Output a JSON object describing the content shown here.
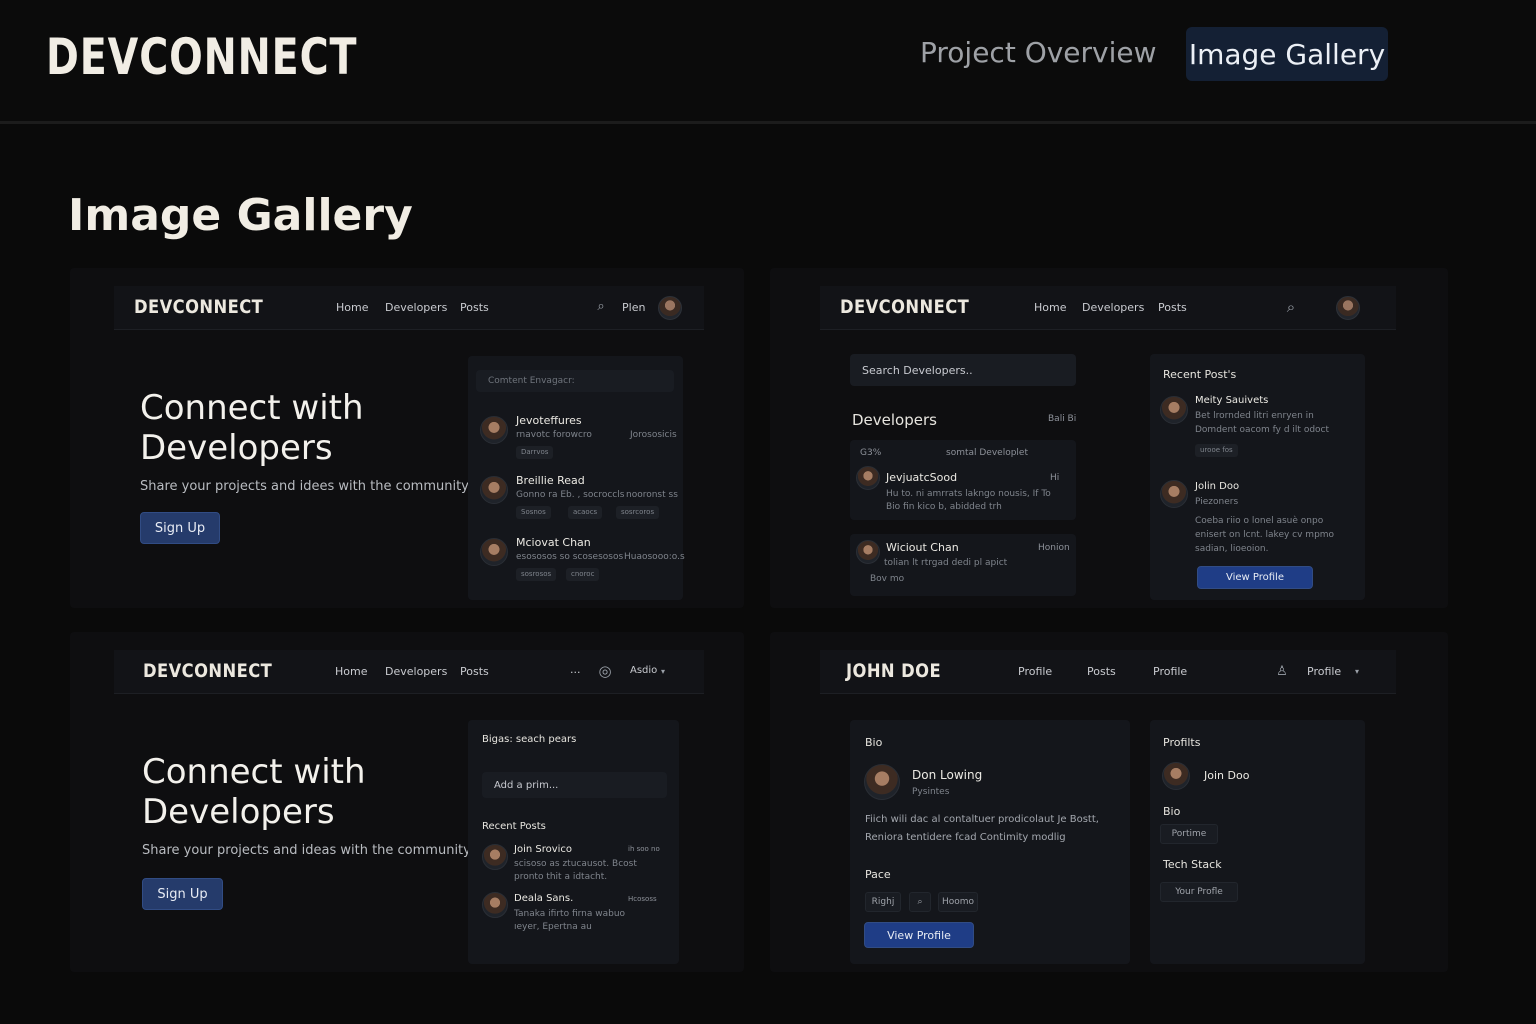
{
  "header": {
    "brand": "DEVCONNECT",
    "nav": [
      "Project Overview",
      "Image Gallery"
    ],
    "active_tab": "Image Gallery"
  },
  "page_title": "Image Gallery",
  "colors": {
    "accent": "#253b6b",
    "active_tab_bg": "#142034",
    "background": "#0a0a0a"
  },
  "card1": {
    "brand": "DEVCONNECT",
    "nav": [
      "Home",
      "Developers",
      "Posts"
    ],
    "nav_extra": "Plen",
    "hero_title_1": "Connect with",
    "hero_title_2": "Developers",
    "hero_text": "Share your projects and idees with the community.",
    "button": "Sign Up",
    "panel_placeholder": "Comtent Envagacr:",
    "rows": [
      {
        "name": "Jevoteffures",
        "sub": "rnavotc forowcro",
        "right": "Jorososicis",
        "tags": [
          "Darrvos"
        ]
      },
      {
        "name": "Breillie Read",
        "sub": "Gonno ra Eb. , socroccls",
        "right": "nooronst ss",
        "tags": [
          "Sosnos",
          "acaocs",
          "sosrcoros"
        ]
      },
      {
        "name": "Mciovat Chan",
        "sub": "esososos so scosesosos",
        "right": "Huaosooo:o.s",
        "tags": [
          "sosrosos",
          "cnoroc"
        ]
      }
    ]
  },
  "card2": {
    "brand": "DEVCONNECT",
    "nav": [
      "Home",
      "Developers",
      "Posts"
    ],
    "search_placeholder": "Search Developers..",
    "developers_title": "Developers",
    "developers_right": "Bali Bi",
    "stats_1": "G3%",
    "stats_2": "somtal Developlet",
    "dev_rows": [
      {
        "name": "JevjuatcSood",
        "line1": "Hu to. ni amrrats lakngo nousis, If To",
        "line2": "Bio fin kico b, abidded trh",
        "right": "Hi"
      },
      {
        "name": "Wiciout Chan",
        "line1": "tolian lt rtrgad dedi pl apict",
        "line2": "Bov mo",
        "right": "Honion"
      }
    ],
    "recent_title": "Recent Post's",
    "posts": [
      {
        "name": "Meity Sauivets",
        "line1": "Bet lrornded litri enryen in",
        "line2": "Domdent oacom fy d ilt odoct",
        "tag": "urooe fos"
      },
      {
        "name": "Jolin Doo",
        "role": "Piezoners",
        "line1": "Coeba riio o lonel asuè onpo",
        "line2": "enisert on lcnt. lakey cv mpmo",
        "line3": "sadian, lioeoion."
      }
    ],
    "button": "View Profile"
  },
  "card3": {
    "brand": "DEVCONNECT",
    "nav": [
      "Home",
      "Developers",
      "Posts"
    ],
    "nav_dots": "...",
    "nav_user": "Asdio",
    "hero_title_1": "Connect with",
    "hero_title_2": "Developers",
    "hero_text": "Share your projects and ideas with the community.",
    "button": "Sign Up",
    "panel_title": "Bigas: seach pears",
    "panel_input": "Add a prim...",
    "recent_title": "Recent Posts",
    "posts": [
      {
        "name": "Join Srovico",
        "line1": "scisoso as ztucausot. Bcost",
        "line2": "pronto thit a idtacht.",
        "right": "ih soo no"
      },
      {
        "name": "Deala Sans.",
        "line1": "Tanaka ifirto firna wabuo",
        "line2": "ıeyer, Epertna au",
        "right": "Hcososs"
      }
    ]
  },
  "card4": {
    "brand": "JOHN DOE",
    "nav": [
      "Profile",
      "Posts",
      "Profile"
    ],
    "nav_user": "Profile",
    "bio_title": "Bio",
    "person_name": "Don Lowing",
    "person_role": "Pysintes",
    "bio_line1": "Fiich wili dac al contaltuer prodicolaut Je Bostt,",
    "bio_line2": "Reniora tentidere fcad Contimity modlig",
    "pace_title": "Pace",
    "pace_tags": [
      "Righj",
      "Hoomo"
    ],
    "button": "View Profile",
    "side_title": "Profilts",
    "side_name": "Join Doo",
    "side_bio": "Bio",
    "side_bio_tag": "Portime",
    "side_stack": "Tech Stack",
    "side_stack_tag": "Your Profle"
  }
}
